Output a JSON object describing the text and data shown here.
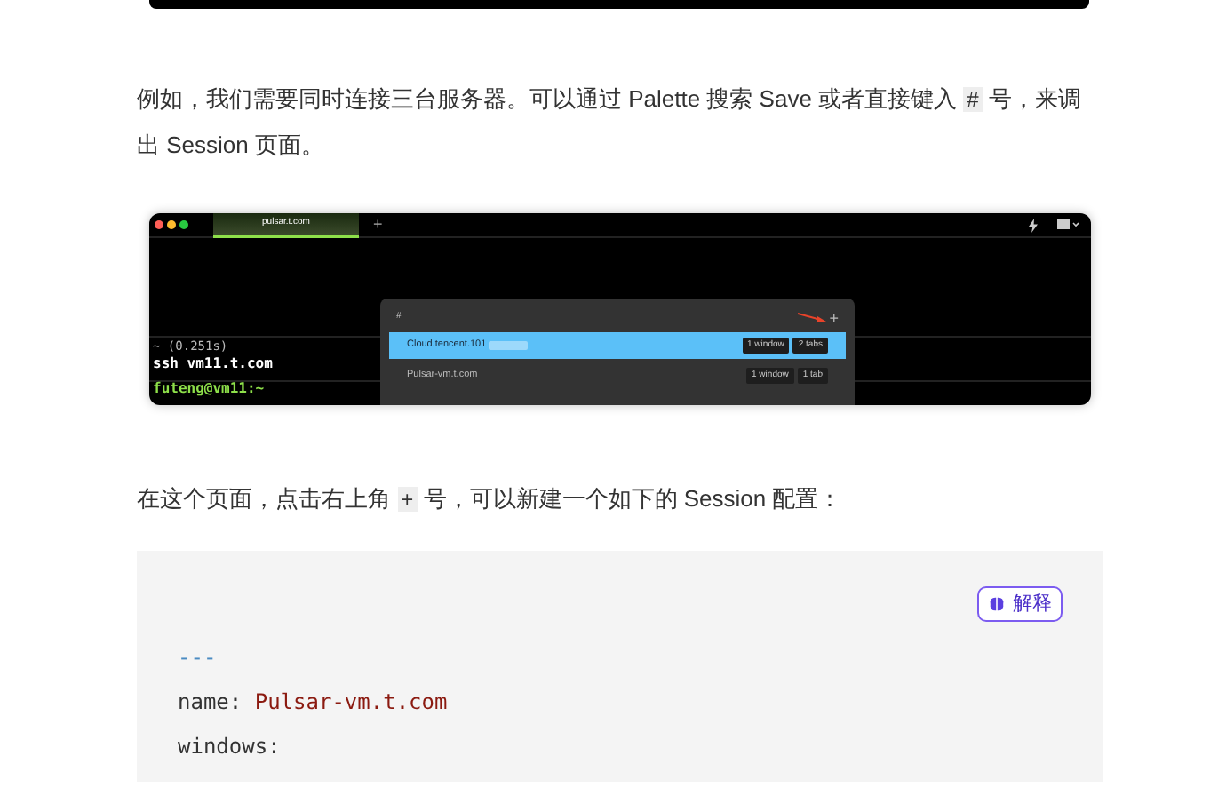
{
  "intro": [
    {
      "kind": "text",
      "text": "例如，我们需要同时连接三台服务器。可以通过 Palette 搜索 Save 或者直接键入 "
    },
    {
      "kind": "code",
      "text": "#"
    },
    {
      "kind": "text",
      "text": " 号，来调出 Session 页面。"
    }
  ],
  "terminal": {
    "tabs": [
      {
        "label": "pulsar.t.com",
        "selected": true
      }
    ],
    "new_tab": "+",
    "lines": [
      {
        "kind": "meta",
        "text": "~ (0.251s)"
      },
      {
        "kind": "command",
        "text": "ssh vm11.t.com"
      },
      {
        "kind": "prompt",
        "text": "futeng@vm11:~"
      }
    ],
    "palette": {
      "query": "#",
      "add": "+",
      "sessions": [
        {
          "name": "Cloud.tencent.101",
          "redacted": true,
          "selected": true,
          "badges": [
            "1 window",
            "2 tabs"
          ]
        },
        {
          "name": "Pulsar-vm.t.com",
          "redacted": false,
          "selected": false,
          "badges": [
            "1 window",
            "1 tab"
          ]
        }
      ]
    }
  },
  "outro": [
    {
      "kind": "text",
      "text": "在这个页面，点击右上角 "
    },
    {
      "kind": "code",
      "text": "+"
    },
    {
      "kind": "text",
      "text": " 号，可以新建一个如下的 Session 配置："
    }
  ],
  "code_block": {
    "explain_button": "解释",
    "lines": [
      {
        "kind": "separator",
        "text": "---"
      },
      {
        "kind": "pair",
        "key": "name:",
        "value": "Pulsar-vm.t.com"
      },
      {
        "kind": "pair",
        "key": "windows:"
      }
    ]
  }
}
